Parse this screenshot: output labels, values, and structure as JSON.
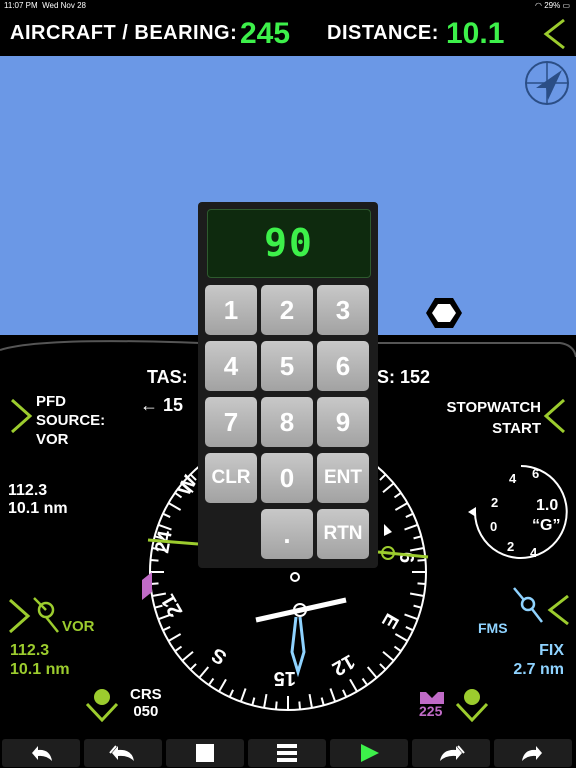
{
  "status": {
    "time": "11:07 PM",
    "date": "Wed Nov 28",
    "battery": "29%"
  },
  "header": {
    "bearing_label": "AIRCRAFT / BEARING:",
    "bearing_value": "245",
    "distance_label": "DISTANCE:",
    "distance_value": "10.1"
  },
  "pfd": {
    "source_line1": "PFD",
    "source_line2": "SOURCE:",
    "source_line3": "VOR",
    "tas_label": "TAS:",
    "gs_label": "S: 152",
    "wind_value": "15",
    "nav_freq": "112.3",
    "nav_dist": "10.1 nm",
    "stopwatch_label": "STOPWATCH",
    "stopwatch_action": "START",
    "g_value": "1.0",
    "g_unit": "“G”",
    "g_ticks": [
      "6",
      "4",
      "2",
      "0",
      "2",
      "4"
    ],
    "vor_label": "VOR",
    "vor_freq": "112.3",
    "vor_dist": "10.1 nm",
    "fms_label": "FMS",
    "fix_label": "FIX",
    "fix_dist": "2.7 nm",
    "crs_label": "CRS",
    "crs_value": "050",
    "hdg_bug_value": "225",
    "compass_labels": [
      "W",
      "24",
      "21",
      "S",
      "15",
      "12",
      "E",
      "6"
    ]
  },
  "keypad": {
    "display": "90",
    "keys": [
      "1",
      "2",
      "3",
      "4",
      "5",
      "6",
      "7",
      "8",
      "9",
      "CLR",
      "0",
      "ENT",
      ".",
      "RTN"
    ]
  },
  "colors": {
    "green": "#3df04a",
    "olive": "#9ccc2e",
    "cyan": "#8fd3ff",
    "magenta": "#c06bc7",
    "sky": "#6b98e6"
  }
}
